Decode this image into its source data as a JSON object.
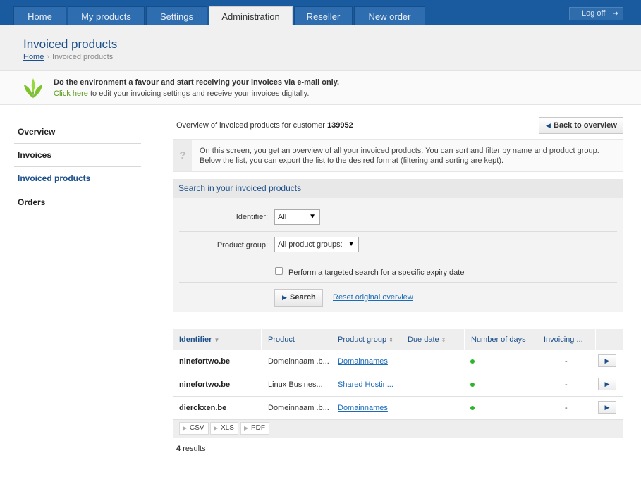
{
  "nav": {
    "tabs": [
      {
        "label": "Home"
      },
      {
        "label": "My products"
      },
      {
        "label": "Settings"
      },
      {
        "label": "Administration",
        "active": true
      },
      {
        "label": "Reseller"
      },
      {
        "label": "New order"
      }
    ],
    "logoff": "Log off"
  },
  "header": {
    "title": "Invoiced products",
    "breadcrumb": {
      "home": "Home",
      "current": "Invoiced products"
    }
  },
  "eco": {
    "title": "Do the environment a favour and start receiving your invoices via e-mail only.",
    "link": "Click here",
    "text": "to edit your invoicing settings and receive your invoices digitally."
  },
  "sidebar": {
    "items": [
      {
        "label": "Overview"
      },
      {
        "label": "Invoices"
      },
      {
        "label": "Invoiced products",
        "active": true
      },
      {
        "label": "Orders"
      }
    ]
  },
  "main": {
    "overview_prefix": "Overview of invoiced products for customer",
    "customer_id": "139952",
    "back_button": "Back to overview",
    "info_line1": "On this screen, you get an overview of all your invoiced products. You can sort and filter by name and product group.",
    "info_line2": "Below the list, you can export the list to the desired format (filtering and sorting are kept).",
    "info_icon": "?"
  },
  "search": {
    "title": "Search in your invoiced products",
    "identifier_label": "Identifier:",
    "identifier_value": "All",
    "group_label": "Product group:",
    "group_value": "All product groups:",
    "expiry_label": "Perform a targeted search for a specific expiry date",
    "search_button": "Search",
    "reset_link": "Reset original overview"
  },
  "table": {
    "headers": [
      "Identifier",
      "Product",
      "Product group",
      "Due date",
      "Number of days",
      "Invoicing ..."
    ],
    "rows": [
      {
        "identifier": "ninefortwo.be",
        "product": "Domeinnaam .b...",
        "group": "Domainnames",
        "status": "green",
        "invoicing": "-"
      },
      {
        "identifier": "ninefortwo.be",
        "product": "Linux Busines...",
        "group": "Shared Hostin...",
        "status": "green",
        "invoicing": "-"
      },
      {
        "identifier": "dierckxen.be",
        "product": "Domeinnaam .b...",
        "group": "Domainnames",
        "status": "green",
        "invoicing": "-"
      }
    ],
    "exports": [
      "CSV",
      "XLS",
      "PDF"
    ],
    "results_count": "4",
    "results_label": "results"
  },
  "colors": {
    "nav_bg": "#1a5a9e",
    "accent": "#1b4f8a",
    "status_green": "#2bb52b",
    "eco_link": "#5a9a1c"
  }
}
